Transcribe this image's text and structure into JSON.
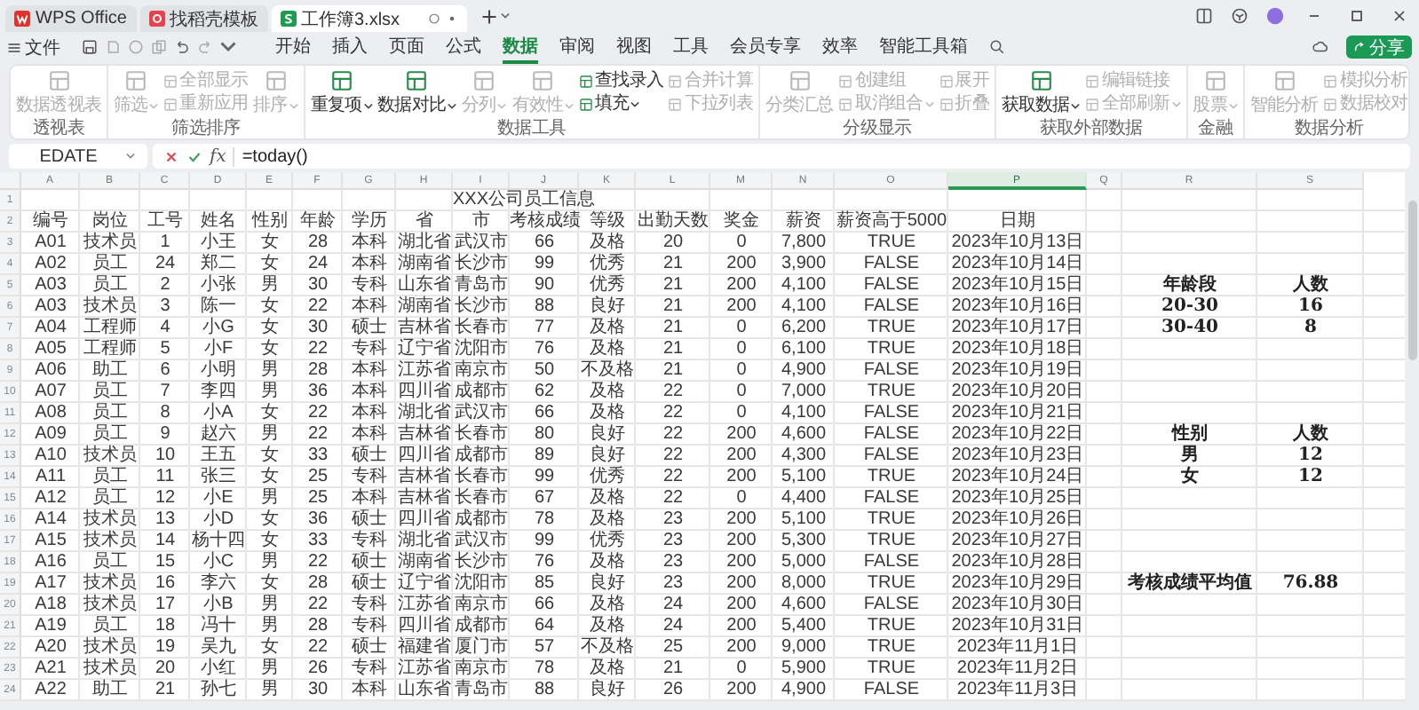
{
  "tabs": [
    {
      "label": "WPS Office",
      "kind": "home",
      "selected": false
    },
    {
      "label": "找稻壳模板",
      "kind": "template",
      "selected": false
    },
    {
      "label": "工作簿3.xlsx",
      "kind": "sheet",
      "selected": true
    }
  ],
  "menu": {
    "file": "文件",
    "items": [
      {
        "label": "开始",
        "selected": false
      },
      {
        "label": "插入",
        "selected": false
      },
      {
        "label": "页面",
        "selected": false
      },
      {
        "label": "公式",
        "selected": false
      },
      {
        "label": "数据",
        "selected": true
      },
      {
        "label": "审阅",
        "selected": false
      },
      {
        "label": "视图",
        "selected": false
      },
      {
        "label": "工具",
        "selected": false
      },
      {
        "label": "会员专享",
        "selected": false
      },
      {
        "label": "效率",
        "selected": false
      },
      {
        "label": "智能工具箱",
        "selected": false
      }
    ],
    "share": "分享"
  },
  "ribbon": [
    {
      "label": "透视表",
      "items": [
        {
          "label": "数据透视表",
          "kind": "large",
          "disabled": true,
          "dropdown": false
        }
      ]
    },
    {
      "label": "筛选排序",
      "items": [
        {
          "label": "筛选",
          "kind": "large",
          "disabled": true,
          "dropdown": true
        },
        {
          "label": "全部显示",
          "kind": "small",
          "disabled": true,
          "dropdown": false
        },
        {
          "label": "重新应用",
          "kind": "small",
          "disabled": true,
          "dropdown": false
        },
        {
          "label": "排序",
          "kind": "large",
          "disabled": true,
          "dropdown": true
        }
      ]
    },
    {
      "label": "数据工具",
      "items": [
        {
          "label": "重复项",
          "kind": "large",
          "disabled": false,
          "dropdown": true
        },
        {
          "label": "数据对比",
          "kind": "large",
          "disabled": false,
          "dropdown": true
        },
        {
          "label": "分列",
          "kind": "large",
          "disabled": true,
          "dropdown": true
        },
        {
          "label": "有效性",
          "kind": "large",
          "disabled": true,
          "dropdown": true
        },
        {
          "label": "查找录入",
          "kind": "small",
          "disabled": false,
          "dropdown": false
        },
        {
          "label": "填充",
          "kind": "small",
          "disabled": false,
          "dropdown": true
        },
        {
          "label": "合并计算",
          "kind": "small",
          "disabled": true,
          "dropdown": false
        },
        {
          "label": "下拉列表",
          "kind": "small",
          "disabled": true,
          "dropdown": false
        }
      ]
    },
    {
      "label": "分级显示",
      "items": [
        {
          "label": "分类汇总",
          "kind": "large",
          "disabled": true,
          "dropdown": false
        },
        {
          "label": "创建组",
          "kind": "small",
          "disabled": true,
          "dropdown": false
        },
        {
          "label": "取消组合",
          "kind": "small",
          "disabled": true,
          "dropdown": true
        },
        {
          "label": "展开",
          "kind": "small",
          "disabled": true,
          "dropdown": false
        },
        {
          "label": "折叠",
          "kind": "small",
          "disabled": true,
          "dropdown": false
        }
      ]
    },
    {
      "label": "获取外部数据",
      "items": [
        {
          "label": "获取数据",
          "kind": "large",
          "disabled": false,
          "dropdown": true
        },
        {
          "label": "编辑链接",
          "kind": "small",
          "disabled": true,
          "dropdown": false
        },
        {
          "label": "全部刷新",
          "kind": "small",
          "disabled": true,
          "dropdown": true
        }
      ]
    },
    {
      "label": "金融",
      "items": [
        {
          "label": "股票",
          "kind": "large",
          "disabled": true,
          "dropdown": true
        }
      ]
    },
    {
      "label": "数据分析",
      "items": [
        {
          "label": "智能分析",
          "kind": "large",
          "disabled": true,
          "dropdown": false
        },
        {
          "label": "模拟分析",
          "kind": "small",
          "disabled": true,
          "dropdown": false
        },
        {
          "label": "数据校对",
          "kind": "small",
          "disabled": true,
          "dropdown": false
        }
      ]
    }
  ],
  "formula_bar": {
    "name_box": "EDATE",
    "function_label": "fx",
    "formula": "=today()"
  },
  "sheet": {
    "columns": [
      {
        "label": "A",
        "selected": false
      },
      {
        "label": "B",
        "selected": false
      },
      {
        "label": "C",
        "selected": false
      },
      {
        "label": "D",
        "selected": false
      },
      {
        "label": "E",
        "selected": false
      },
      {
        "label": "F",
        "selected": false
      },
      {
        "label": "G",
        "selected": false
      },
      {
        "label": "H",
        "selected": false
      },
      {
        "label": "I",
        "selected": false
      },
      {
        "label": "J",
        "selected": false
      },
      {
        "label": "K",
        "selected": false
      },
      {
        "label": "L",
        "selected": false
      },
      {
        "label": "M",
        "selected": false
      },
      {
        "label": "N",
        "selected": false
      },
      {
        "label": "O",
        "selected": false
      },
      {
        "label": "P",
        "selected": true
      },
      {
        "label": "Q",
        "selected": false
      },
      {
        "label": "R",
        "selected": false
      },
      {
        "label": "S",
        "selected": false
      }
    ],
    "row_numbers": [
      "1",
      "2",
      "3",
      "4",
      "5",
      "6",
      "7",
      "8",
      "9",
      "10",
      "11",
      "12",
      "13",
      "14",
      "15",
      "16",
      "17",
      "18",
      "19",
      "20",
      "21",
      "22",
      "23",
      "24"
    ],
    "title": "XXX公司员工信息",
    "headers": [
      "编号",
      "岗位",
      "工号",
      "姓名",
      "性别",
      "年龄",
      "学历",
      "省",
      "市",
      "考核成绩",
      "等级",
      "出勤天数",
      "奖金",
      "薪资",
      "薪资高于5000",
      "日期"
    ],
    "rows": [
      [
        "A01",
        "技术员",
        "1",
        "小王",
        "女",
        "28",
        "本科",
        "湖北省",
        "武汉市",
        "66",
        "及格",
        "20",
        "0",
        "7,800",
        "TRUE",
        "2023年10月13日"
      ],
      [
        "A02",
        "员工",
        "24",
        "郑二",
        "女",
        "24",
        "本科",
        "湖南省",
        "长沙市",
        "99",
        "优秀",
        "21",
        "200",
        "3,900",
        "FALSE",
        "2023年10月14日"
      ],
      [
        "A03",
        "员工",
        "2",
        "小张",
        "男",
        "30",
        "专科",
        "山东省",
        "青岛市",
        "90",
        "优秀",
        "21",
        "200",
        "4,100",
        "FALSE",
        "2023年10月15日"
      ],
      [
        "A03",
        "技术员",
        "3",
        "陈一",
        "女",
        "22",
        "本科",
        "湖南省",
        "长沙市",
        "88",
        "良好",
        "21",
        "200",
        "4,100",
        "FALSE",
        "2023年10月16日"
      ],
      [
        "A04",
        "工程师",
        "4",
        "小G",
        "女",
        "30",
        "硕士",
        "吉林省",
        "长春市",
        "77",
        "及格",
        "21",
        "0",
        "6,200",
        "TRUE",
        "2023年10月17日"
      ],
      [
        "A05",
        "工程师",
        "5",
        "小F",
        "女",
        "22",
        "专科",
        "辽宁省",
        "沈阳市",
        "76",
        "及格",
        "21",
        "0",
        "6,100",
        "TRUE",
        "2023年10月18日"
      ],
      [
        "A06",
        "助工",
        "6",
        "小明",
        "男",
        "28",
        "本科",
        "江苏省",
        "南京市",
        "50",
        "不及格",
        "21",
        "0",
        "4,900",
        "FALSE",
        "2023年10月19日"
      ],
      [
        "A07",
        "员工",
        "7",
        "李四",
        "男",
        "36",
        "本科",
        "四川省",
        "成都市",
        "62",
        "及格",
        "22",
        "0",
        "7,000",
        "TRUE",
        "2023年10月20日"
      ],
      [
        "A08",
        "员工",
        "8",
        "小A",
        "女",
        "22",
        "本科",
        "湖北省",
        "武汉市",
        "66",
        "及格",
        "22",
        "0",
        "4,100",
        "FALSE",
        "2023年10月21日"
      ],
      [
        "A09",
        "员工",
        "9",
        "赵六",
        "男",
        "22",
        "本科",
        "吉林省",
        "长春市",
        "80",
        "良好",
        "22",
        "200",
        "4,600",
        "FALSE",
        "2023年10月22日"
      ],
      [
        "A10",
        "技术员",
        "10",
        "王五",
        "女",
        "33",
        "硕士",
        "四川省",
        "成都市",
        "89",
        "良好",
        "22",
        "200",
        "4,300",
        "FALSE",
        "2023年10月23日"
      ],
      [
        "A11",
        "员工",
        "11",
        "张三",
        "女",
        "25",
        "专科",
        "吉林省",
        "长春市",
        "99",
        "优秀",
        "22",
        "200",
        "5,100",
        "TRUE",
        "2023年10月24日"
      ],
      [
        "A12",
        "员工",
        "12",
        "小E",
        "男",
        "25",
        "本科",
        "吉林省",
        "长春市",
        "67",
        "及格",
        "22",
        "0",
        "4,400",
        "FALSE",
        "2023年10月25日"
      ],
      [
        "A14",
        "技术员",
        "13",
        "小D",
        "女",
        "36",
        "硕士",
        "四川省",
        "成都市",
        "78",
        "及格",
        "23",
        "200",
        "5,100",
        "TRUE",
        "2023年10月26日"
      ],
      [
        "A15",
        "技术员",
        "14",
        "杨十四",
        "女",
        "33",
        "专科",
        "湖北省",
        "武汉市",
        "99",
        "优秀",
        "23",
        "200",
        "5,300",
        "TRUE",
        "2023年10月27日"
      ],
      [
        "A16",
        "员工",
        "15",
        "小C",
        "男",
        "22",
        "硕士",
        "湖南省",
        "长沙市",
        "76",
        "及格",
        "23",
        "200",
        "5,000",
        "FALSE",
        "2023年10月28日"
      ],
      [
        "A17",
        "技术员",
        "16",
        "李六",
        "女",
        "28",
        "硕士",
        "辽宁省",
        "沈阳市",
        "85",
        "良好",
        "23",
        "200",
        "8,000",
        "TRUE",
        "2023年10月29日"
      ],
      [
        "A18",
        "技术员",
        "17",
        "小B",
        "男",
        "22",
        "专科",
        "江苏省",
        "南京市",
        "66",
        "及格",
        "24",
        "200",
        "4,600",
        "FALSE",
        "2023年10月30日"
      ],
      [
        "A19",
        "员工",
        "18",
        "冯十",
        "男",
        "28",
        "专科",
        "四川省",
        "成都市",
        "64",
        "及格",
        "24",
        "200",
        "5,400",
        "TRUE",
        "2023年10月31日"
      ],
      [
        "A20",
        "技术员",
        "19",
        "吴九",
        "女",
        "22",
        "硕士",
        "福建省",
        "厦门市",
        "57",
        "不及格",
        "25",
        "200",
        "9,000",
        "TRUE",
        "2023年11月1日"
      ],
      [
        "A21",
        "技术员",
        "20",
        "小红",
        "男",
        "26",
        "专科",
        "江苏省",
        "南京市",
        "78",
        "及格",
        "21",
        "0",
        "5,900",
        "TRUE",
        "2023年11月2日"
      ],
      [
        "A22",
        "助工",
        "21",
        "孙七",
        "男",
        "30",
        "本科",
        "山东省",
        "青岛市",
        "88",
        "良好",
        "26",
        "200",
        "4,900",
        "FALSE",
        "2023年11月3日"
      ]
    ],
    "summary": [
      {
        "rows": [
          [
            "年龄段",
            "人数"
          ],
          [
            "20-30",
            "16"
          ],
          [
            "30-40",
            "8"
          ]
        ]
      },
      {
        "rows": [
          [
            "性别",
            "人数"
          ],
          [
            "男",
            "12"
          ],
          [
            "女",
            "12"
          ]
        ]
      },
      {
        "rows": [
          [
            "考核成绩平均值",
            "76.88"
          ]
        ]
      }
    ]
  }
}
